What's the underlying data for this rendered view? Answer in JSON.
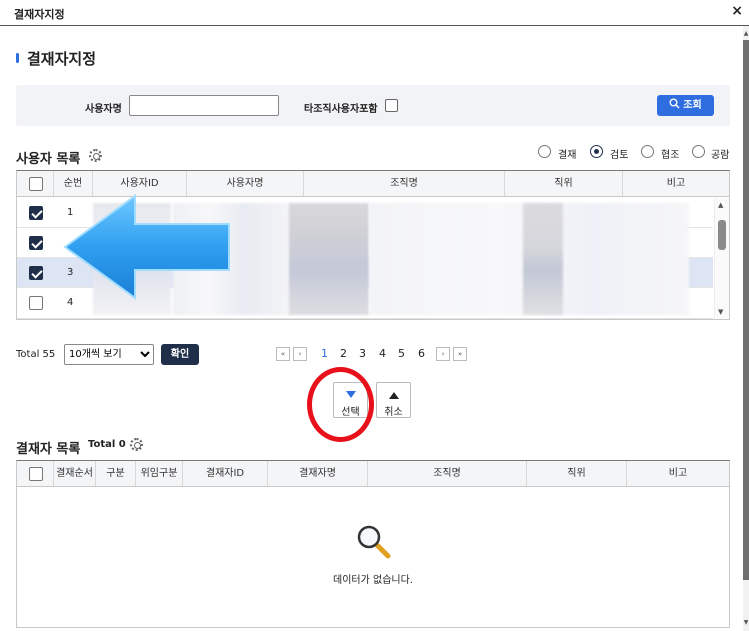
{
  "window": {
    "title": "결재자지정",
    "close": "×"
  },
  "page_title": "결재자지정",
  "search": {
    "user_label": "사용자명",
    "user_value": "",
    "include_label": "타조직사용자포함",
    "search_button": "조회"
  },
  "user_list": {
    "title": "사용자 목록",
    "radios": [
      {
        "label": "결재",
        "checked": false
      },
      {
        "label": "검토",
        "checked": true
      },
      {
        "label": "협조",
        "checked": false
      },
      {
        "label": "공람",
        "checked": false
      }
    ],
    "columns": [
      "순번",
      "사용자ID",
      "사용자명",
      "조직명",
      "직위",
      "비고"
    ],
    "rows": [
      {
        "no": "1",
        "checked": true,
        "selected": false
      },
      {
        "no": "",
        "checked": true,
        "selected": false
      },
      {
        "no": "3",
        "checked": true,
        "selected": true
      },
      {
        "no": "4",
        "checked": false,
        "selected": false
      }
    ]
  },
  "pager": {
    "total": "Total 55",
    "page_size": "10개씩 보기",
    "confirm": "확인",
    "pages": [
      "1",
      "2",
      "3",
      "4",
      "5",
      "6"
    ],
    "current_page": "1"
  },
  "move": {
    "select": "선택",
    "cancel": "취소"
  },
  "approver_list": {
    "title": "결재자 목록",
    "total": "Total 0",
    "columns": [
      "결재순서",
      "구분",
      "위임구분",
      "결재자ID",
      "결재자명",
      "조직명",
      "직위",
      "비고"
    ],
    "empty": "데이터가 없습니다."
  },
  "colors": {
    "accent": "#2f6ee0",
    "dark_button": "#1f2f4a",
    "arrow": "#3aa8f0",
    "highlight_circle": "#e8101a"
  }
}
